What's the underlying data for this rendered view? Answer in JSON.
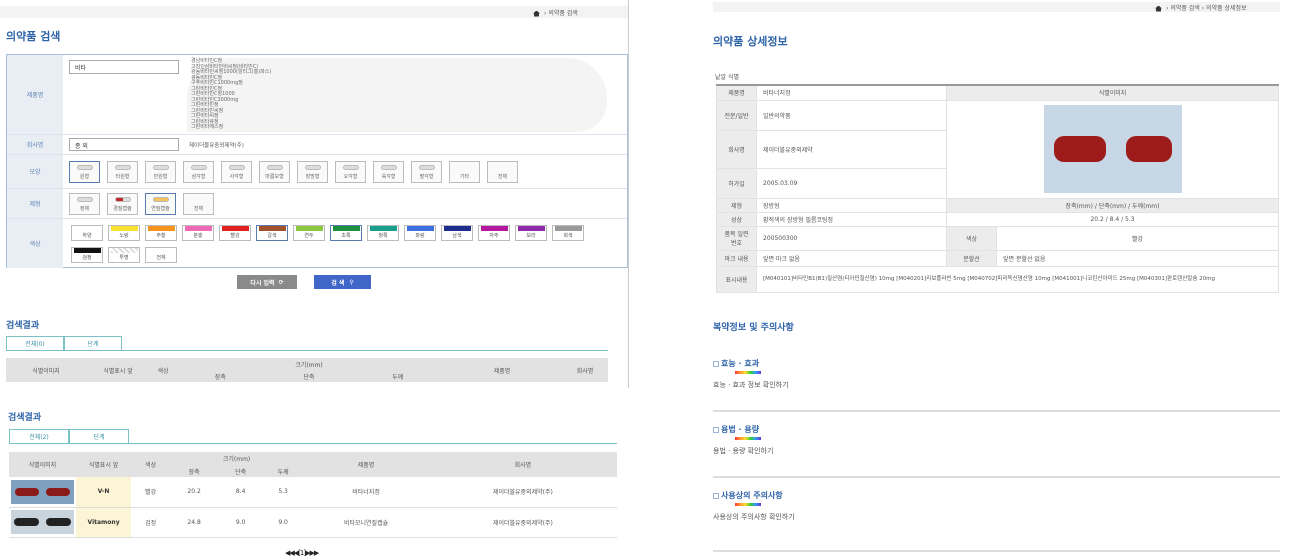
{
  "left": {
    "breadcrumb": "의약품 검색",
    "title": "의약품 검색",
    "form": {
      "product_label": "제품명",
      "product_value": "비타",
      "suggestions": [
        "경남비타민C정",
        "고려인삼비타민비씨정(비타민C)",
        "광동비타민씨정1000(알리그(흥)파스)",
        "광동비타민C정",
        "구주비타민C1000mg정",
        "그린비타민C정",
        "그린비타민C정1000",
        "그린비타민C3000mg",
        "그린비타민정",
        "그린비타민씨정",
        "그린비타씨정",
        "그린비타큐정",
        "그린비타에스정"
      ],
      "company_label": "회사명",
      "company_value": "종 외",
      "company_suggestion": "제이더블유중외제약(주)",
      "shape_label": "모양",
      "shapes": [
        "원형",
        "타원형",
        "반원형",
        "삼각형",
        "사각형",
        "마름모형",
        "장방형",
        "오각형",
        "육각형",
        "팔각형",
        "기타",
        "전체"
      ],
      "form_label": "제형",
      "forms": [
        "정제",
        "경질캡슐",
        "연질캡슐",
        "전체"
      ],
      "color_label": "색상",
      "colors": [
        {
          "name": "하양",
          "hex": "#ffffff"
        },
        {
          "name": "노랑",
          "hex": "#f7e12e"
        },
        {
          "name": "주황",
          "hex": "#f7941d"
        },
        {
          "name": "분홍",
          "hex": "#ef69b6"
        },
        {
          "name": "빨강",
          "hex": "#e32020"
        },
        {
          "name": "갈색",
          "hex": "#a0522d"
        },
        {
          "name": "연두",
          "hex": "#8dc63f"
        },
        {
          "name": "초록",
          "hex": "#1e8f3e"
        },
        {
          "name": "청록",
          "hex": "#1a9e8c"
        },
        {
          "name": "파랑",
          "hex": "#3d6fe0"
        },
        {
          "name": "남색",
          "hex": "#1d2e8f"
        },
        {
          "name": "자주",
          "hex": "#b5179e"
        },
        {
          "name": "보라",
          "hex": "#8e2aa8"
        },
        {
          "name": "회색",
          "hex": "#9a9a9a"
        },
        {
          "name": "검정",
          "hex": "#111111"
        },
        {
          "name": "투명",
          "hex": "#e5e5e5"
        },
        {
          "name": "전체",
          "hex": ""
        }
      ],
      "reset_button": "다시 입력",
      "search_button": "검 색"
    },
    "results_title_1": "검색결과",
    "tabs_1": [
      "전체(0)",
      "단계"
    ],
    "results_title_2": "검색결과",
    "tabs_2": [
      "전체(2)",
      "단계"
    ],
    "headers": {
      "image": "식별이미지",
      "mark": "식별표시 앞",
      "color": "색상",
      "size": "크기(mm)",
      "long": "장축",
      "short": "단축",
      "thick": "두께",
      "product": "제품명",
      "company": "회사명"
    },
    "rows": [
      {
        "mark": "V-N",
        "color": "빨강",
        "long": "20.2",
        "short": "8.4",
        "thick": "5.3",
        "product": "비타너지정",
        "company": "제이더블유중외제약(주)"
      },
      {
        "mark": "Vitamony",
        "color": "검정",
        "long": "24.8",
        "short": "9.0",
        "thick": "9.0",
        "product": "비타모니연질캡슐",
        "company": "제이더블유중외제약(주)"
      }
    ],
    "pager": "◀◀◀[1]▶▶▶"
  },
  "right": {
    "breadcrumb": [
      "의약품 검색",
      "의약품 상세정보"
    ],
    "title": "의약품 상세정보",
    "subhead": "낱알 식별",
    "rows": [
      {
        "label": "제품명",
        "value": "비타너지정",
        "extra": "식별이미지"
      },
      {
        "label": "전문/일반",
        "value": "일반의약품"
      },
      {
        "label": "회사명",
        "value": "제이더블유중외제약"
      },
      {
        "label": "허가일",
        "value": "2005.03.09"
      },
      {
        "label": "제형",
        "value": "장방형",
        "value2": "장축(mm) / 단축(mm) / 두께(mm)"
      },
      {
        "label": "성상",
        "value": "황적색의 장방형 필름코팅정",
        "value2": "20.2 / 8.4 / 5.3"
      },
      {
        "label": "품목 일련번호",
        "value": "200500300",
        "label2": "색상",
        "value2": "빨강"
      },
      {
        "label": "마크 내용",
        "value": "앞면 마크 없음",
        "label2": "분할선",
        "value2": "앞면 분할선 없음"
      },
      {
        "label": "표시내용",
        "value": "[M040101]비타민B1(B1)질산염(티아민질산염) 10mg [M040201]리보플라빈 5mg [M040702]피리독신염산염 10mg [M041001]니코틴산아미드 25mg [M040301]판토텐산칼슘 20mg"
      }
    ],
    "info_title": "복약정보 및 주의사항",
    "sections": [
      {
        "title": "효능 · 효과",
        "text": "효능 · 효과 정보 확인하기"
      },
      {
        "title": "용법 · 용량",
        "text": "용법 · 용량 확인하기"
      },
      {
        "title": "사용상의 주의사항",
        "text": "사용상의 주의사항 확인하기"
      }
    ]
  }
}
